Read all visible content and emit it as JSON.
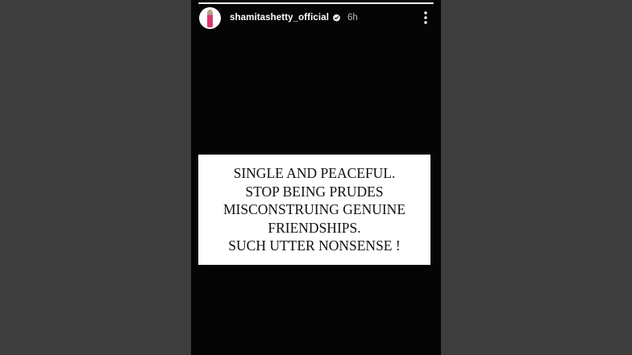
{
  "story": {
    "progress": 1.0,
    "header": {
      "username": "shamitashetty_official",
      "time_ago": "6h",
      "avatar_icon": "profile-photo",
      "verified_icon": "verified-badge-icon",
      "more_icon": "more-vertical-icon"
    },
    "text_card": {
      "lines": [
        "SINGLE AND PEACEFUL.",
        "STOP BEING PRUDES",
        "MISCONSTRUING GENUINE",
        "FRIENDSHIPS.",
        "SUCH UTTER NONSENSE !"
      ]
    }
  },
  "colors": {
    "page_background": "#3e3e3e",
    "story_background": "#050505",
    "card_background": "#ffffff",
    "text": "#111111"
  }
}
